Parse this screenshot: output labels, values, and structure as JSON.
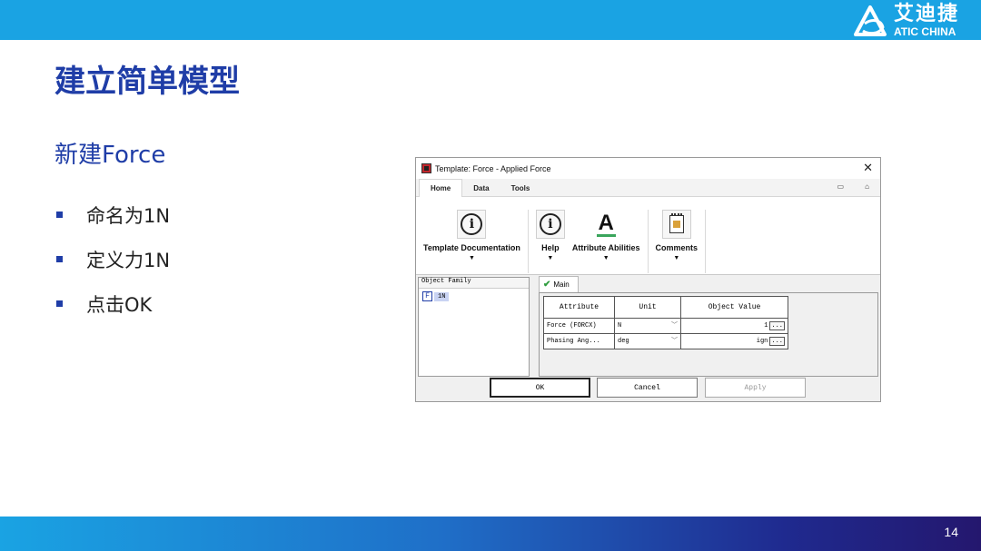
{
  "logo": {
    "cn": "艾迪捷",
    "en": "ATIC CHINA"
  },
  "slide": {
    "title": "建立简单模型",
    "subtitle": "新建Force",
    "bullets": [
      "命名为1N",
      "定义力1N",
      "点击OK"
    ],
    "page_number": "14"
  },
  "dialog": {
    "title": "Template: Force - Applied Force",
    "tabs": [
      "Home",
      "Data",
      "Tools"
    ],
    "active_tab": "Home",
    "ribbon": [
      {
        "label": "Template Documentation",
        "icon": "info-icon"
      },
      {
        "label": "Help",
        "icon": "info-icon"
      },
      {
        "label": "Attribute Abilities",
        "icon": "text-a-icon"
      },
      {
        "label": "Comments",
        "icon": "notepad-icon"
      }
    ],
    "family": {
      "header": "Object Family",
      "item_icon": "F",
      "item_label": "1N"
    },
    "main_tab": "Main",
    "grid": {
      "headers": [
        "Attribute",
        "Unit",
        "Object Value"
      ],
      "rows": [
        {
          "attribute": "Force (FORCX)",
          "unit": "N",
          "value": "1"
        },
        {
          "attribute": "Phasing Ang...",
          "unit": "deg",
          "value": "ign"
        }
      ]
    },
    "buttons": {
      "ok": "OK",
      "cancel": "Cancel",
      "apply": "Apply"
    }
  },
  "colors": {
    "brand_blue": "#1aa3e3",
    "title_blue": "#1f3da7"
  }
}
